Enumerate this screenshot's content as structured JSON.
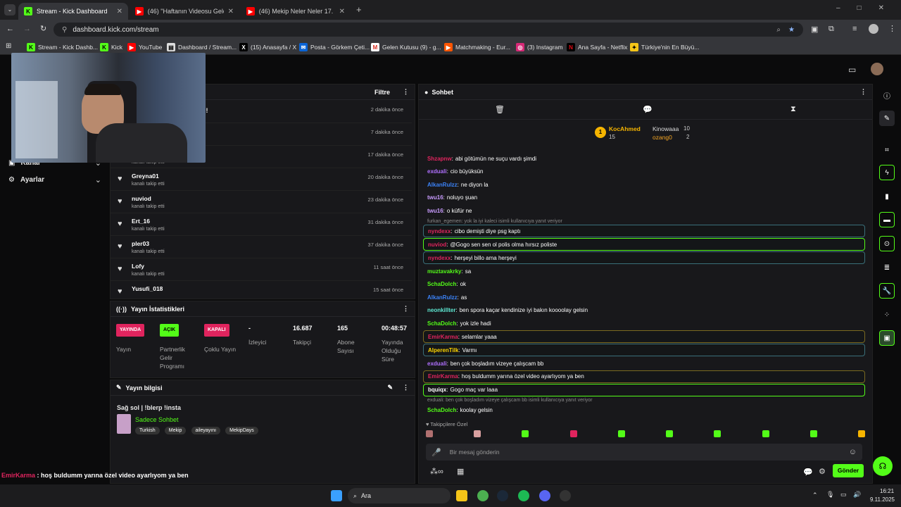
{
  "browser": {
    "tabs": [
      {
        "title": "Stream - Kick Dashboard",
        "active": true
      },
      {
        "title": "(46) \"Haftanın Videosu Geldi\" K",
        "active": false
      },
      {
        "title": "(46) Mekip Neler Neler 17. Bölü",
        "active": false
      }
    ],
    "url": "dashboard.kick.com/stream",
    "bookmarks": [
      "Stream - Kick Dashb...",
      "Kick",
      "YouTube",
      "Dashboard / Stream...",
      "(15) Anasayfa / X",
      "Posta - Görkem Çeti...",
      "Gelen Kutusu (9) - g...",
      "Matchmaking - Eur...",
      "(3) Instagram",
      "Ana Sayfa - Netflix",
      "Türkiye'nin En Büyü..."
    ]
  },
  "sidebar": {
    "kanal": "Kanal",
    "ayarlar": "Ayarlar"
  },
  "feed": {
    "filter_label": "Filtre",
    "first_tail": "u!",
    "items": [
      {
        "name": "",
        "sub": "",
        "time": "2 dakika önce"
      },
      {
        "name": "",
        "sub": "",
        "time": "7 dakika önce"
      },
      {
        "name": "",
        "sub": "kanalı takip etti",
        "time": "17 dakika önce"
      },
      {
        "name": "Greyna01",
        "sub": "kanalı takip etti",
        "time": "20 dakika önce"
      },
      {
        "name": "nuviod",
        "sub": "kanalı takip etti",
        "time": "23 dakika önce"
      },
      {
        "name": "Ert_16",
        "sub": "kanalı takip etti",
        "time": "31 dakika önce"
      },
      {
        "name": "pler03",
        "sub": "kanalı takip etti",
        "time": "37 dakika önce"
      },
      {
        "name": "Lofy",
        "sub": "kanalı takip etti",
        "time": "11 saat önce"
      },
      {
        "name": "Yusufi_018",
        "sub": "",
        "time": "15 saat önce"
      }
    ]
  },
  "stats": {
    "title": "Yayın İstatistikleri",
    "yayin_badge": "YAYINDA",
    "yayin_label": "Yayın",
    "partner_badge": "AÇIK",
    "partner_label": "Partnerlik Gelir Programı",
    "coklu_badge": "KAPALI",
    "coklu_label": "Çoklu Yayın",
    "izleyici_value": "-",
    "izleyici_label": "İzleyici",
    "takipci_value": "16.687",
    "takipci_label": "Takipçi",
    "abone_value": "165",
    "abone_label": "Abone Sayısı",
    "sure_value": "00:48:57",
    "sure_label": "Yayında Olduğu Süre"
  },
  "info": {
    "title": "Yayın bilgisi",
    "stream_title": "Sağ sol | !blerp !insta",
    "category": "Sadece Sohbet",
    "tags": [
      "Turkish",
      "Mekip",
      "aileyayını",
      "MekipDays"
    ]
  },
  "chat": {
    "title": "Sohbet",
    "top": [
      {
        "name": "KocAhmed",
        "count": "15"
      },
      {
        "name": "Kinowaaa",
        "count": "10"
      },
      {
        "name": "ozang0",
        "count": "2"
      }
    ],
    "messages": [
      {
        "user": "Shzapnw",
        "text": "abi götümün ne suçu vardı şimdi",
        "color": "#e0245e"
      },
      {
        "user": "exduali",
        "text": "cio büyüksün",
        "color": "#b070ff"
      },
      {
        "user": "AlkanRulzz",
        "text": "ne diyon la",
        "color": "#3b82f6"
      },
      {
        "user": "twu16",
        "text": "noluyo şuan",
        "color": "#c99cff"
      },
      {
        "user": "twu16",
        "text": "o küfür ne",
        "color": "#c99cff"
      },
      {
        "reply": "furkan_egemen: yok la iyi kaleci isimli kullanıcıya yanıt veriyor",
        "user": "nyndexx",
        "text": "cibo demişti diye psg kaptı",
        "color": "#e0245e"
      },
      {
        "user": "nuviod",
        "text": "@Gogo sen sen ol polis olma hırsız poliste",
        "color": "#e0245e"
      },
      {
        "user": "nyndexx",
        "text": "herşeyi billo ama herşeyi",
        "color": "#e0245e"
      },
      {
        "user": "muztavakrky",
        "text": "sa",
        "color": "#53fc18"
      },
      {
        "user": "SchaDolch",
        "text": "ok",
        "color": "#53fc18"
      },
      {
        "user": "AlkanRulzz",
        "text": "as",
        "color": "#3b82f6"
      },
      {
        "user": "neonkillter",
        "text": "ben spora kaçar kendinize iyi bakın koooolay gelsin",
        "color": "#5eead4"
      },
      {
        "user": "SchaDolch",
        "text": "yok izle hadi",
        "color": "#53fc18"
      },
      {
        "user": "EmirKarma",
        "text": "selamlar yaaa",
        "color": "#e0245e"
      },
      {
        "user": "AlperenTilk",
        "text": "Varmı",
        "color": "#ffd600"
      },
      {
        "user": "exduali",
        "text": "ben çok boşladım vizeye çalışcam bb",
        "color": "#b070ff"
      },
      {
        "user": "EmirKarma",
        "text": "hoş buldumm yarına özel video ayarlıyom ya ben",
        "color": "#e0245e"
      },
      {
        "user": "bquiqx",
        "text": "Gogo maç var laaa",
        "color": "#fff"
      },
      {
        "reply": "exduali: ben çok boşladım vizeye çalışcam bb isimli kullanıcıya yanıt veriyor",
        "user": "SchaDolch",
        "text": "koolay gelsin",
        "color": "#53fc18"
      }
    ],
    "followers_only": "Takipçilere Özel",
    "input_placeholder": "Bir mesaj gönderin",
    "send_label": "Gönder"
  },
  "overlay": [
    {
      "user": "EmirKarma",
      "text": " : hoş buldumm yarına özel video ayarlıyom ya ben",
      "color": "#e0245e"
    },
    {
      "user": "bquiqx",
      "text": " : Gogo maç var laaa",
      "color": "#ffffff"
    },
    {
      "user": "SchaDolch",
      "text": " : koolay gelsin",
      "color": "#53fc18"
    }
  ],
  "taskbar": {
    "search_label": "Ara",
    "time": "16:21",
    "date": "9.11.2025"
  },
  "colors": {
    "accent": "#53fc18",
    "live": "#e0245e"
  }
}
